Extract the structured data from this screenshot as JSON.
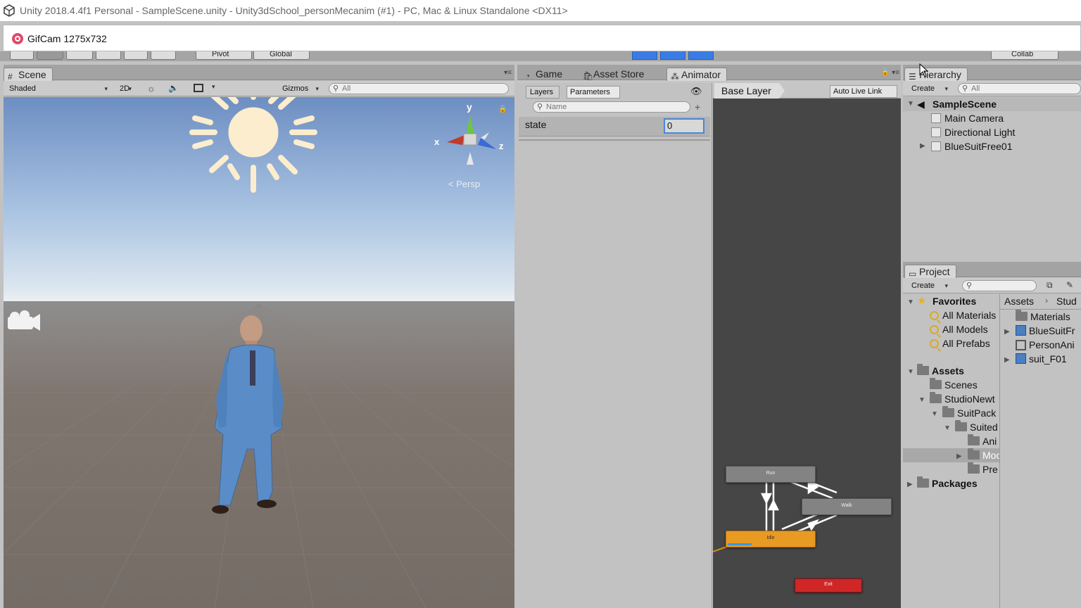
{
  "window": {
    "title": "Unity 2018.4.4f1 Personal - SampleScene.unity - Unity3dSchool_personMecanim (#1) - PC, Mac & Linux Standalone <DX11>"
  },
  "gifcam": {
    "title": "GifCam 1275x732"
  },
  "toolbar": {
    "pivot": "Pivot",
    "global": "Global",
    "collab": "Collab"
  },
  "scene": {
    "tab": "Scene",
    "shading": "Shaded",
    "mode_2d": "2D",
    "gizmos": "Gizmos",
    "search_placeholder": "All",
    "axis_y": "y",
    "axis_x": "x",
    "axis_z": "z",
    "projection": "Persp"
  },
  "animator": {
    "tabs": [
      "Game",
      "Asset Store",
      "Animator"
    ],
    "layers_tab": "Layers",
    "parameters_tab": "Parameters",
    "breadcrumb": "Base Layer",
    "auto_live_link": "Auto Live Link",
    "name_placeholder": "Name",
    "param_name": "state",
    "param_value": "0",
    "states": {
      "run": "Run",
      "walk": "Walk",
      "idle": "Idle",
      "exit": "Exit"
    }
  },
  "hierarchy": {
    "tab": "Hierarchy",
    "create": "Create",
    "search_placeholder": "All",
    "scene": "SampleScene",
    "items": [
      "Main Camera",
      "Directional Light",
      "BlueSuitFree01"
    ]
  },
  "project": {
    "tab": "Project",
    "create": "Create",
    "favorites": "Favorites",
    "fav_items": [
      "All Materials",
      "All Models",
      "All Prefabs"
    ],
    "assets": "Assets",
    "tree": [
      "Scenes",
      "StudioNewt",
      "SuitPack",
      "Suited",
      "Ani",
      "Moc",
      "Pre"
    ],
    "packages": "Packages",
    "breadcrumb_root": "Assets",
    "breadcrumb_next": "Stud",
    "right_items": [
      "Materials",
      "BlueSuitFr",
      "PersonAni",
      "suit_F01"
    ]
  },
  "colors": {
    "accent": "#3b7ce4",
    "idle_state": "#e99a22",
    "exit_state": "#d02626",
    "sky_top": "#6f93c9",
    "ground": "#7b716b"
  }
}
